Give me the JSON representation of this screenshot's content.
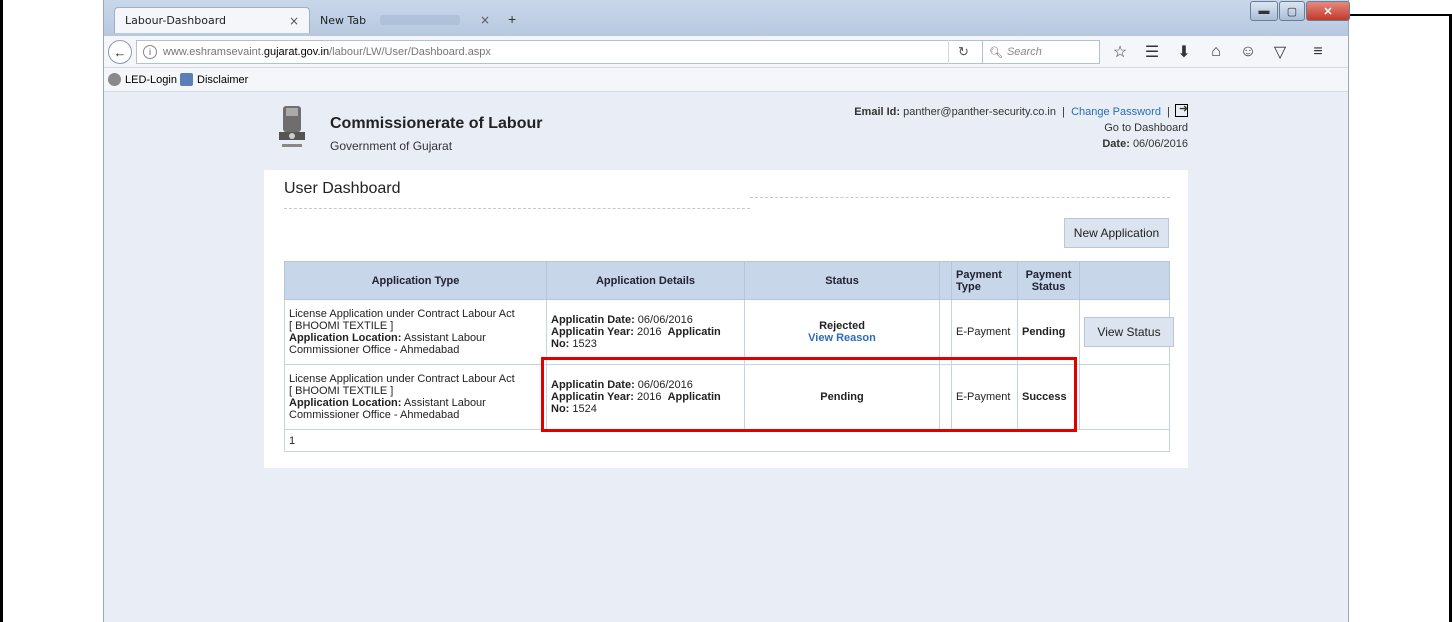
{
  "browser": {
    "tabs": [
      {
        "label": "Labour-Dashboard",
        "close": "×"
      },
      {
        "label": "New Tab",
        "close": "×"
      }
    ],
    "new_tab": "+",
    "url_host": "www.eshramsevaint.",
    "url_domain": "gujarat.gov.in",
    "url_path": "/labour/LW/User/Dashboard.aspx",
    "search_placeholder": "Search",
    "bookmarks": [
      "LED-Login",
      "Disclaimer"
    ],
    "window_controls": {
      "minimize": "▬",
      "maximize": "▢",
      "close": "✕"
    }
  },
  "header": {
    "org_name": "Commissionerate of Labour",
    "org_sub": "Government of Gujarat",
    "email_label": "Email Id:",
    "email": "panther@panther-security.co.in",
    "separator": "|",
    "change_password": "Change Password",
    "go_dashboard": "Go to Dashboard",
    "date_label": "Date:",
    "date": "06/06/2016"
  },
  "dashboard": {
    "title": "User Dashboard",
    "new_application_label": "New Application",
    "columns": [
      "Application Type",
      "Application Details",
      "Status",
      "Payment Type",
      "Payment Status",
      ""
    ],
    "rows": [
      {
        "type_line1": "License Application under Contract Labour Act",
        "type_line2": "[ BHOOMI TEXTILE ]",
        "location_label": "Application Location:",
        "location": "Assistant Labour Commissioner Office - Ahmedabad",
        "date_label": "Applicatin Date:",
        "date": "06/06/2016",
        "year_label": "Applicatin Year:",
        "year": "2016",
        "no_label": "Applicatin No:",
        "no": "1523",
        "status": "Rejected",
        "status_link": "View Reason",
        "payment_type": "E-Payment",
        "payment_status": "Pending",
        "action": "View Status"
      },
      {
        "type_line1": "License Application under Contract Labour Act",
        "type_line2": "[ BHOOMI TEXTILE ]",
        "location_label": "Application Location:",
        "location": "Assistant Labour Commissioner Office - Ahmedabad",
        "date_label": "Applicatin Date:",
        "date": "06/06/2016",
        "year_label": "Applicatin Year:",
        "year": "2016",
        "no_label": "Applicatin No:",
        "no": "1524",
        "status": "Pending",
        "status_link": "",
        "payment_type": "E-Payment",
        "payment_status": "Success",
        "action": ""
      }
    ],
    "pager": "1"
  },
  "colors": {
    "highlight": "#e00000",
    "table_header": "#c7d6e8",
    "link": "#2a6db4",
    "page_bg": "#e9eef6"
  }
}
